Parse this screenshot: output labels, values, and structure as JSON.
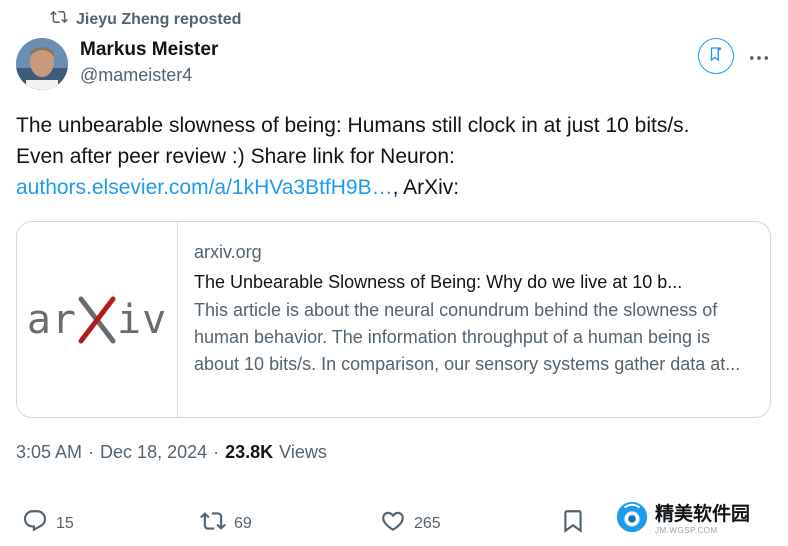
{
  "repost": {
    "label": "Jieyu Zheng reposted"
  },
  "author": {
    "name": "Markus Meister",
    "handle": "@mameister4"
  },
  "tweet": {
    "text_1": "The unbearable slowness of being: Humans still clock in at just 10 bits/s.",
    "text_2": "Even after peer review :) Share link for Neuron:",
    "link_1": "authors.elsevier.com/a/1kHVa3BtfH9B…",
    "text_3": ", ArXiv:"
  },
  "card": {
    "domain": "arxiv.org",
    "title": "The Unbearable Slowness of Being: Why do we live at 10 b...",
    "description": "This article is about the neural conundrum behind the slowness of human behavior. The information throughput of a human being is about 10 bits/s. In comparison, our sensory systems gather data at...",
    "logo_text_left": "ar",
    "logo_text_right": "iv"
  },
  "meta": {
    "time": "3:05 AM",
    "sep_1": "·",
    "date": "Dec 18, 2024",
    "sep_2": "·",
    "views_count": "23.8K",
    "views_label": "Views"
  },
  "actions": {
    "replies": "15",
    "reposts": "69",
    "likes": "265"
  },
  "watermark": {
    "title": "精美软件园",
    "subtitle": "JM.WGSP.COM"
  },
  "colors": {
    "accent": "#1d9bf0",
    "muted": "#536471",
    "text": "#0f1419",
    "border": "#cfd9de",
    "arxiv_red": "#b31b1b"
  }
}
